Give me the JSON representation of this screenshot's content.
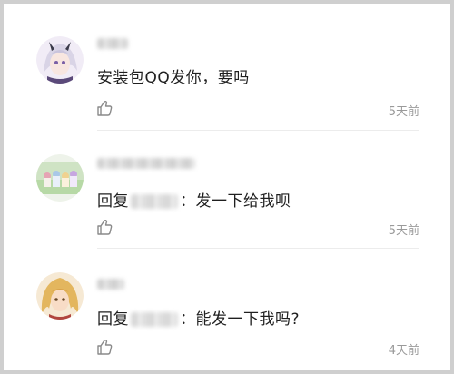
{
  "comments": [
    {
      "text": "安装包QQ发你，要吗",
      "time": "5天前"
    },
    {
      "reply_prefix": "回复",
      "reply_text": "发一下给我呗",
      "time": "5天前"
    },
    {
      "reply_prefix": "回复",
      "reply_text": "能发一下我吗?",
      "time": "4天前"
    }
  ],
  "colors": {
    "text": "#1f1f1f",
    "time": "#9a9a9a",
    "frame": "#cfcfcf"
  },
  "icons": [
    "thumbs-up-icon"
  ]
}
